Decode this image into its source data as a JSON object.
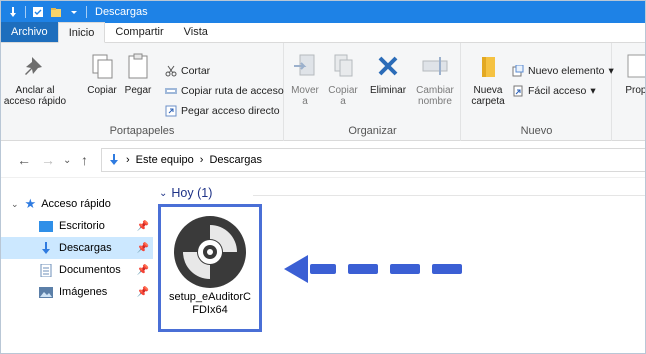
{
  "window": {
    "title": "Descargas"
  },
  "tabs": [
    "Archivo",
    "Inicio",
    "Compartir",
    "Vista"
  ],
  "ribbon": {
    "portapapeles": {
      "pin_label": "Anclar al acceso rápido",
      "copy_label": "Copiar",
      "paste_label": "Pegar",
      "cut_label": "Cortar",
      "copy_path_label": "Copiar ruta de acceso",
      "paste_shortcut_label": "Pegar acceso directo",
      "group_label": "Portapapeles"
    },
    "organizar": {
      "move_label": "Mover a",
      "copyto_label": "Copiar a",
      "delete_label": "Eliminar",
      "rename_label": "Cambiar nombre",
      "group_label": "Organizar"
    },
    "nuevo": {
      "new_folder_label": "Nueva carpeta",
      "new_item_label": "Nuevo elemento",
      "easy_access_label": "Fácil acceso",
      "group_label": "Nuevo"
    },
    "abrir": {
      "properties_label": "Propi"
    }
  },
  "address": {
    "segments": [
      "Este equipo",
      "Descargas"
    ]
  },
  "nav_pane": {
    "quick_access": "Acceso rápido",
    "items": [
      "Escritorio",
      "Descargas",
      "Documentos",
      "Imágenes"
    ]
  },
  "content": {
    "group_header": "Hoy (1)",
    "file": {
      "name": "setup_eAuditorCFDIx64"
    }
  },
  "colors": {
    "titlebar": "#1e82e6",
    "selection": "#cce8ff",
    "highlight_border": "#4a6fd6",
    "arrow": "#3b5fd4"
  }
}
